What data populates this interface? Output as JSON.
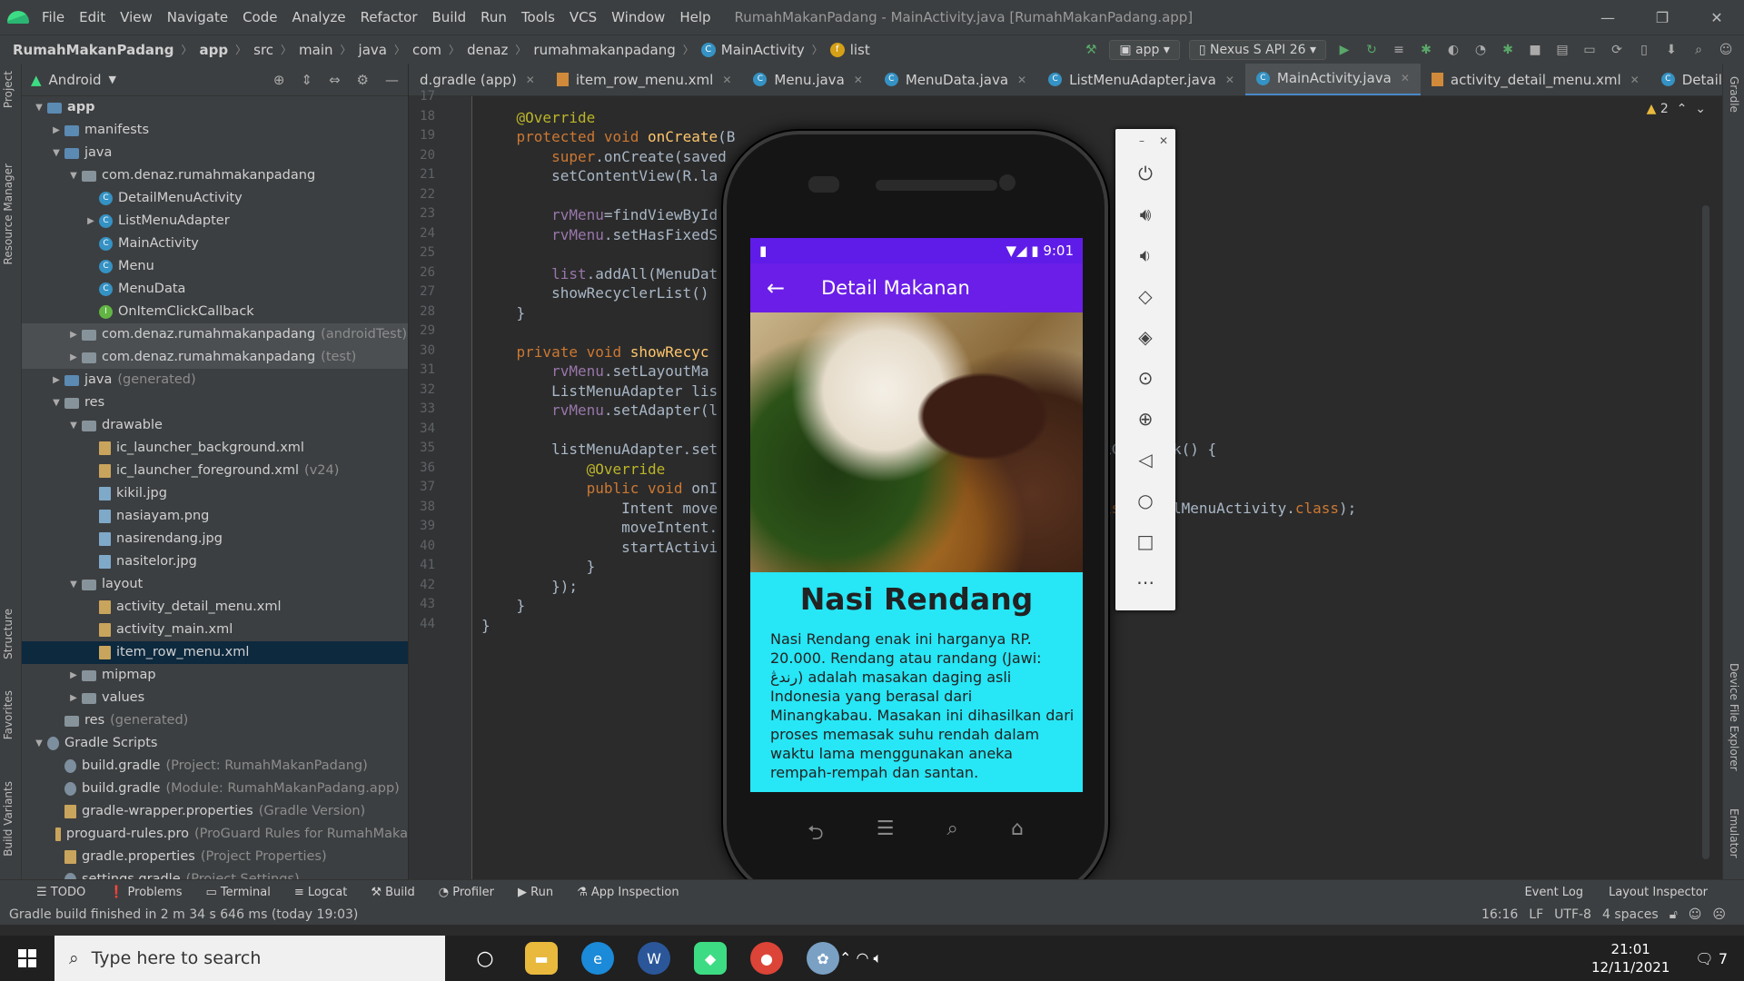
{
  "titlebar": {
    "menus": [
      "File",
      "Edit",
      "View",
      "Navigate",
      "Code",
      "Analyze",
      "Refactor",
      "Build",
      "Run",
      "Tools",
      "VCS",
      "Window",
      "Help"
    ],
    "window_title": "RumahMakanPadang - MainActivity.java [RumahMakanPadang.app]"
  },
  "navbar": {
    "crumbs": [
      "RumahMakanPadang",
      "app",
      "src",
      "main",
      "java",
      "com",
      "denaz",
      "rumahmakanpadang",
      "MainActivity",
      "list"
    ],
    "config": "app",
    "device": "Nexus S API 26"
  },
  "project_panel": {
    "view": "Android",
    "tree": [
      {
        "label": "app",
        "muted": "",
        "depth": 0,
        "arrow": "▼",
        "icon": "fold-blue",
        "bold": true
      },
      {
        "label": "manifests",
        "muted": "",
        "depth": 1,
        "arrow": "▶",
        "icon": "fold-blue"
      },
      {
        "label": "java",
        "muted": "",
        "depth": 1,
        "arrow": "▼",
        "icon": "fold-blue"
      },
      {
        "label": "com.denaz.rumahmakanpadang",
        "muted": "",
        "depth": 2,
        "arrow": "▼",
        "icon": "fold"
      },
      {
        "label": "DetailMenuActivity",
        "muted": "",
        "depth": 3,
        "arrow": "",
        "icon": "cls"
      },
      {
        "label": "ListMenuAdapter",
        "muted": "",
        "depth": 3,
        "arrow": "▶",
        "icon": "cls"
      },
      {
        "label": "MainActivity",
        "muted": "",
        "depth": 3,
        "arrow": "",
        "icon": "cls"
      },
      {
        "label": "Menu",
        "muted": "",
        "depth": 3,
        "arrow": "",
        "icon": "cls"
      },
      {
        "label": "MenuData",
        "muted": "",
        "depth": 3,
        "arrow": "",
        "icon": "cls"
      },
      {
        "label": "OnItemClickCallback",
        "muted": "",
        "depth": 3,
        "arrow": "",
        "icon": "itf"
      },
      {
        "label": "com.denaz.rumahmakanpadang",
        "muted": "(androidTest)",
        "depth": 2,
        "arrow": "▶",
        "icon": "fold",
        "dim": true
      },
      {
        "label": "com.denaz.rumahmakanpadang",
        "muted": "(test)",
        "depth": 2,
        "arrow": "▶",
        "icon": "fold",
        "dim": true
      },
      {
        "label": "java",
        "muted": "(generated)",
        "depth": 1,
        "arrow": "▶",
        "icon": "fold-blue"
      },
      {
        "label": "res",
        "muted": "",
        "depth": 1,
        "arrow": "▼",
        "icon": "fold"
      },
      {
        "label": "drawable",
        "muted": "",
        "depth": 2,
        "arrow": "▼",
        "icon": "fold"
      },
      {
        "label": "ic_launcher_background.xml",
        "muted": "",
        "depth": 3,
        "arrow": "",
        "icon": "file"
      },
      {
        "label": "ic_launcher_foreground.xml",
        "muted": "(v24)",
        "depth": 3,
        "arrow": "",
        "icon": "file"
      },
      {
        "label": "kikil.jpg",
        "muted": "",
        "depth": 3,
        "arrow": "",
        "icon": "img"
      },
      {
        "label": "nasiayam.png",
        "muted": "",
        "depth": 3,
        "arrow": "",
        "icon": "img"
      },
      {
        "label": "nasirendang.jpg",
        "muted": "",
        "depth": 3,
        "arrow": "",
        "icon": "img"
      },
      {
        "label": "nasitelor.jpg",
        "muted": "",
        "depth": 3,
        "arrow": "",
        "icon": "img"
      },
      {
        "label": "layout",
        "muted": "",
        "depth": 2,
        "arrow": "▼",
        "icon": "fold"
      },
      {
        "label": "activity_detail_menu.xml",
        "muted": "",
        "depth": 3,
        "arrow": "",
        "icon": "file"
      },
      {
        "label": "activity_main.xml",
        "muted": "",
        "depth": 3,
        "arrow": "",
        "icon": "file"
      },
      {
        "label": "item_row_menu.xml",
        "muted": "",
        "depth": 3,
        "arrow": "",
        "icon": "file",
        "sel": true
      },
      {
        "label": "mipmap",
        "muted": "",
        "depth": 2,
        "arrow": "▶",
        "icon": "fold"
      },
      {
        "label": "values",
        "muted": "",
        "depth": 2,
        "arrow": "▶",
        "icon": "fold"
      },
      {
        "label": "res",
        "muted": "(generated)",
        "depth": 1,
        "arrow": "",
        "icon": "fold"
      },
      {
        "label": "Gradle Scripts",
        "muted": "",
        "depth": 0,
        "arrow": "▼",
        "icon": "grad"
      },
      {
        "label": "build.gradle",
        "muted": "(Project: RumahMakanPadang)",
        "depth": 1,
        "arrow": "",
        "icon": "grad"
      },
      {
        "label": "build.gradle",
        "muted": "(Module: RumahMakanPadang.app)",
        "depth": 1,
        "arrow": "",
        "icon": "grad"
      },
      {
        "label": "gradle-wrapper.properties",
        "muted": "(Gradle Version)",
        "depth": 1,
        "arrow": "",
        "icon": "file"
      },
      {
        "label": "proguard-rules.pro",
        "muted": "(ProGuard Rules for RumahMaka",
        "depth": 1,
        "arrow": "",
        "icon": "file"
      },
      {
        "label": "gradle.properties",
        "muted": "(Project Properties)",
        "depth": 1,
        "arrow": "",
        "icon": "file"
      },
      {
        "label": "settings.gradle",
        "muted": "(Project Settings)",
        "depth": 1,
        "arrow": "",
        "icon": "grad"
      }
    ]
  },
  "left_tools": [
    "Project",
    "Resource Manager",
    "Structure",
    "Favorites",
    "Build Variants"
  ],
  "right_tools": [
    "Gradle",
    "Device File Explorer",
    "Emulator"
  ],
  "tabs": [
    {
      "label": "d.gradle (app)",
      "type": "grad"
    },
    {
      "label": "item_row_menu.xml",
      "type": "xml"
    },
    {
      "label": "Menu.java",
      "type": "cls"
    },
    {
      "label": "MenuData.java",
      "type": "cls"
    },
    {
      "label": "ListMenuAdapter.java",
      "type": "cls"
    },
    {
      "label": "MainActivity.java",
      "type": "cls",
      "active": true
    },
    {
      "label": "activity_detail_menu.xml",
      "type": "xml"
    },
    {
      "label": "DetailMenuActivity.java",
      "type": "cls"
    }
  ],
  "editor": {
    "warnings": "2",
    "line_numbers": [
      "17",
      "18",
      "19",
      "20",
      "21",
      "22",
      "23",
      "24",
      "25",
      "26",
      "27",
      "28",
      "29",
      "30",
      "31",
      "32",
      "33",
      "34",
      "35",
      "36",
      "37",
      "38",
      "39",
      "40",
      "41",
      "42",
      "43",
      "44"
    ],
    "lines": [
      "",
      "    <an>@Override</an>",
      "    <kw>protected void</kw> <fn>onCreate</fn>(B",
      "        <kw>super</kw>.onCreate(saved",
      "        setContentView(R.la",
      "",
      "        <fld>rvMenu</fld>=findViewById",
      "        <fld>rvMenu</fld>.setHasFixedS",
      "",
      "        <fld>list</fld>.addAll(MenuDat",
      "        showRecyclerList()",
      "    }",
      "",
      "    <kw>private void</kw> <fn>showRecyc</fn>",
      "        <fld>rvMenu</fld>.setLayoutMa",
      "        ListMenuAdapter lis",
      "        <fld>rvMenu</fld>.setAdapter(l",
      "",
      "        listMenuAdapter.set                                           ckCallback() {",
      "            <an>@Override</an>",
      "            <kw>public void</kw> onI",
      "                Intent move                                       ty.<kw>this</kw>,DetailMenuActivity.<kw>class</kw>);",
      "                moveIntent.                                       nu);",
      "                startActivi",
      "            }",
      "        });",
      "    }",
      "}"
    ]
  },
  "bottom_tools": [
    "TODO",
    "Problems",
    "Terminal",
    "Logcat",
    "Build",
    "Profiler",
    "Run",
    "App Inspection"
  ],
  "bottom_right_tools": [
    "Event Log",
    "Layout Inspector"
  ],
  "status": {
    "message": "Gradle build finished in 2 m 34 s 646 ms (today 19:03)",
    "position": "16:16",
    "line_sep": "LF",
    "encoding": "UTF-8",
    "indent": "4 spaces"
  },
  "taskbar": {
    "search_placeholder": "Type here to search",
    "time": "21:01",
    "date": "12/11/2021",
    "notifications": "7"
  },
  "phone": {
    "time": "9:01",
    "appbar_title": "Detail Makanan",
    "dish_title": "Nasi Rendang",
    "description": "Nasi Rendang enak ini harganya RP. 20.000. Rendang atau randang (Jawi: رندڠ) adalah masakan daging asli Indonesia yang berasal dari Minangkabau. Masakan ini dihasilkan dari proses memasak suhu rendah dalam waktu lama menggunakan aneka rempah-rempah dan santan."
  },
  "colors": {
    "accent": "#6a1ee8",
    "screen_bg": "#27e6f5",
    "editor_bg": "#2b2b2b"
  }
}
